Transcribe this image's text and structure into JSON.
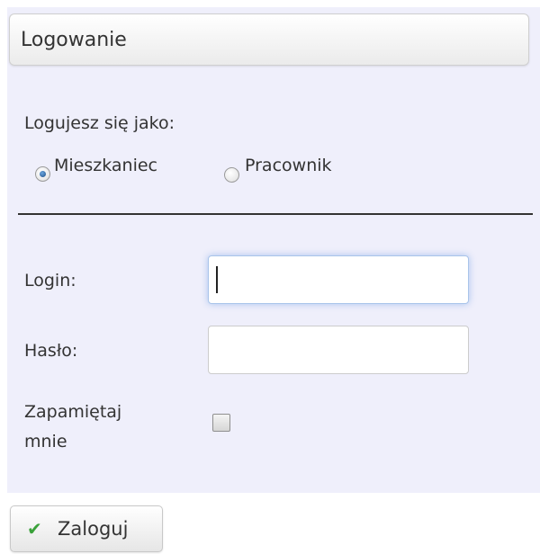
{
  "form": {
    "title": "Logowanie",
    "login_as_label": "Logujesz się jako:",
    "role_options": [
      {
        "label": "Mieszkaniec",
        "selected": true
      },
      {
        "label": "Pracownik",
        "selected": false
      }
    ],
    "login_label": "Login:",
    "login_value": "",
    "password_label": "Hasło:",
    "password_value": "",
    "remember_label_line1": "Zapamiętaj",
    "remember_label_line2": "mnie",
    "remember_checked": false,
    "submit_label": "Zaloguj",
    "submit_icon": "checkmark-icon"
  },
  "colors": {
    "panel_background": "#efeffb",
    "checkmark": "#3aa13a",
    "focus_glow": "#528ce1"
  }
}
